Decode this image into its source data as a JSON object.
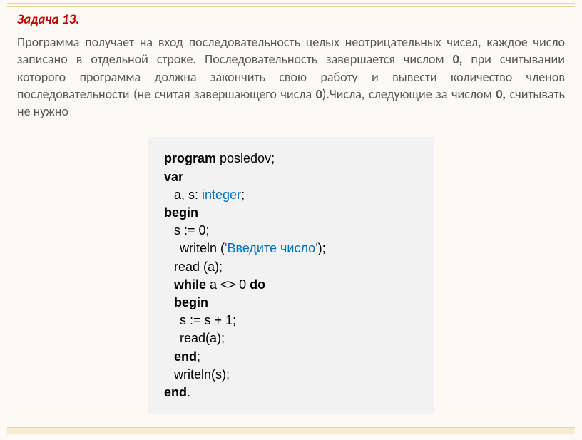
{
  "title": "Задача 13.",
  "description_parts": {
    "p1": "Программа получает на вход последовательность целых неотрицательных чисел, каждое число записано в отдельной строке. Последовательность завершается числом ",
    "b1": "0,",
    "p2": " при считывании которого программа должна закончить свою работу и вывести количество членов последовательности (не считая завершающего числа ",
    "b2": "0",
    "p3": ").Числа, следующие за числом ",
    "b3": "0,",
    "p4": " считывать не нужно"
  },
  "code": {
    "l1_kw": "program",
    "l1_rest": " posledov;",
    "l2_kw": "var",
    "l3_a": "a, s: ",
    "l3_type": "integer",
    "l3_b": ";",
    "l4_kw": "begin",
    "l5_a": "s := ",
    "l5_num": "0",
    "l5_b": ";",
    "l6_a": "writeln (",
    "l6_str": "'Введите число'",
    "l6_b": ");",
    "l7": "read (a);",
    "l8_kw1": "while",
    "l8_mid": " a <> ",
    "l8_num": "0",
    "l8_sp": " ",
    "l8_kw2": "do",
    "l9_kw": "begin",
    "l10_a": "s := s + ",
    "l10_num": "1",
    "l10_b": ";",
    "l11": "read(a);",
    "l12_kw": "end",
    "l12_b": ";",
    "l13": "writeln(s);",
    "l14_kw": "end",
    "l14_b": "."
  }
}
